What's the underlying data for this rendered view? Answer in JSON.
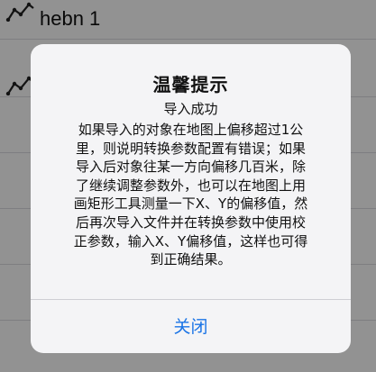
{
  "background_list": {
    "items": [
      {
        "label": "hebn 1",
        "icon": "polyline-icon"
      },
      {
        "label": "",
        "icon": "polyline-icon"
      }
    ]
  },
  "alert": {
    "title": "温馨提示",
    "subtitle": "导入成功",
    "body_lines": [
      "如果导入的对象在地图上偏移超过1公",
      "里，则说明转换参数配置有错误；如果",
      "导入后对象往某一方向偏移几百米，除",
      "了继续调整参数外，也可以在地图上用",
      "画矩形工具测量一下X、Y的偏移值，然",
      "后再次导入文件并在转换参数中使用校",
      "正参数，输入X、Y偏移值，这样也可得",
      "到正确结果。"
    ],
    "close_label": "关闭"
  },
  "colors": {
    "accent": "#1a74e6",
    "dialog_background": "#f4f4f6"
  }
}
